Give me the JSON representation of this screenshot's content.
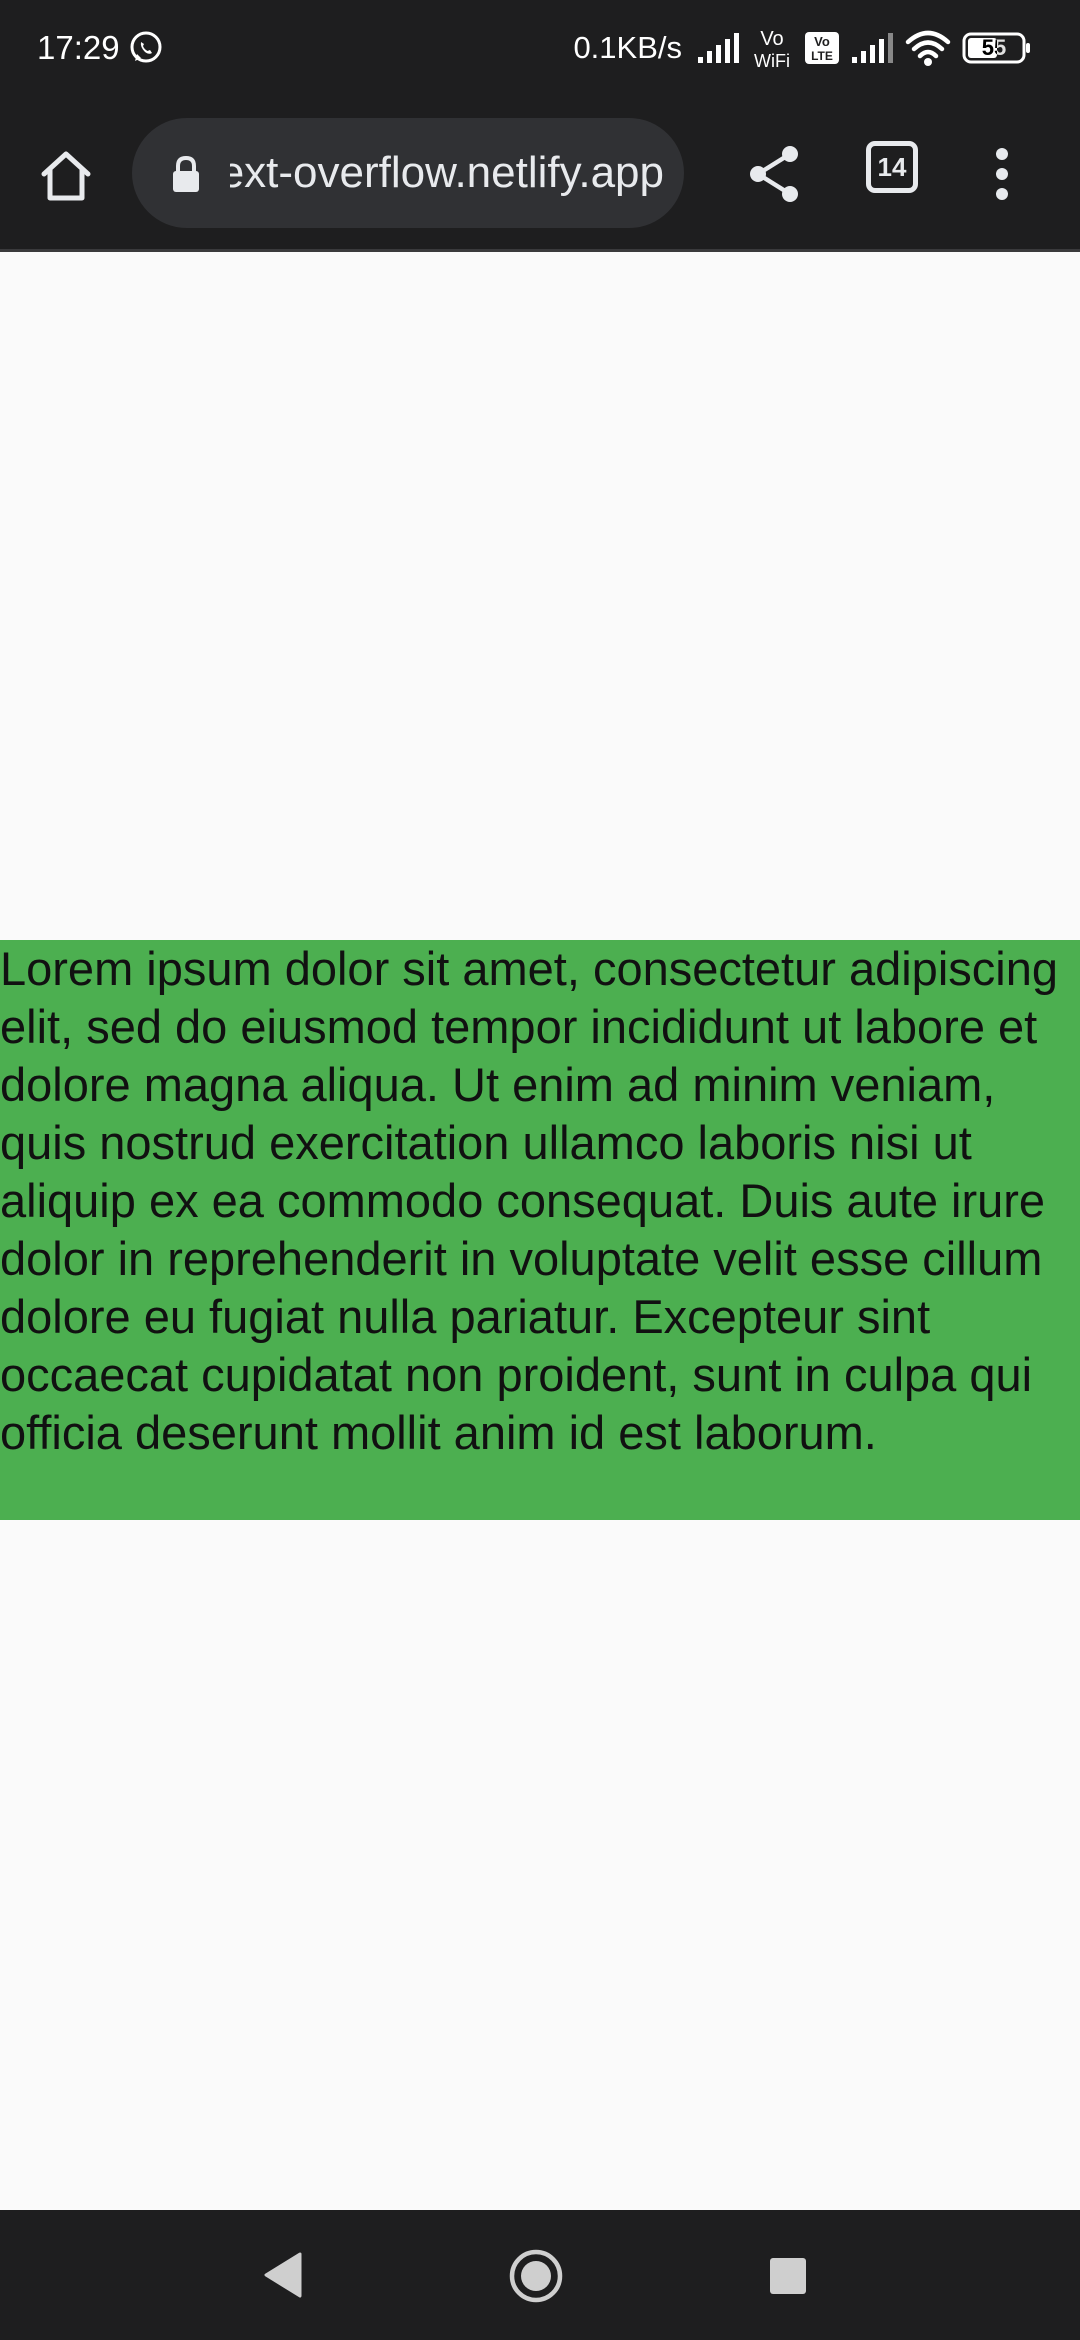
{
  "status_bar": {
    "time": "17:29",
    "net_speed": "0.1KB/s",
    "battery": "55",
    "vowifi_top": "Vo",
    "vowifi_bottom": "WiFi",
    "volte_top": "Vo",
    "volte_bottom": "LTE"
  },
  "toolbar": {
    "url": "text-overflow.netlify.app",
    "tab_count": "14"
  },
  "content": {
    "paragraph": "Lorem ipsum dolor sit amet, consectetur adipiscing elit, sed do eiusmod tempor incididunt ut labore et dolore magna aliqua. Ut enim ad minim veniam, quis nostrud exercitation ullamco laboris nisi ut aliquip ex ea commodo consequat. Duis aute irure dolor in reprehenderit in voluptate velit esse cillum dolore eu fugiat nulla pariatur. Excepteur sint occaecat cupidatat non proident, sunt in culpa qui officia deserunt mollit anim id est laborum."
  },
  "colors": {
    "chrome_bg": "#1e1e1f",
    "omnibox_bg": "#303134",
    "page_bg": "#fafafa",
    "green_block": "#4caf50"
  },
  "icons": {
    "home": "home-icon",
    "lock": "lock-icon",
    "share": "share-icon",
    "menu": "more-vert-icon",
    "back": "back-icon",
    "nav_home": "nav-home-icon",
    "recents": "recents-icon"
  }
}
